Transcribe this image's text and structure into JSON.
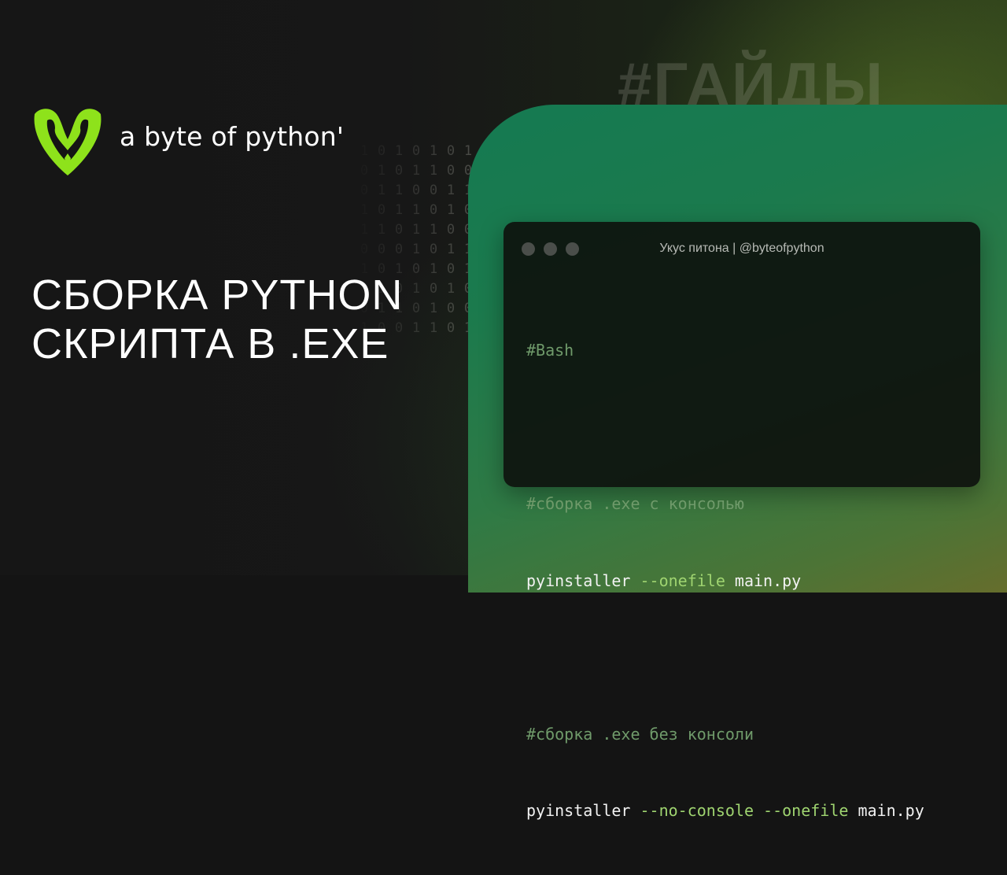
{
  "brand": {
    "name": "a byte of python'",
    "logo_icon": "snake-v-logo-icon",
    "accent_color": "#8ee21b"
  },
  "hashtag": "#ГАЙДЫ",
  "headline": {
    "line1": "СБОРКА PYTHON",
    "line2": "СКРИПТА В .EXE"
  },
  "terminal": {
    "title": "Укус питона | @byteofpython",
    "window_buttons": [
      "dot-icon",
      "dot-icon",
      "dot-icon"
    ],
    "lines": [
      {
        "kind": "comment",
        "text": "#Bash"
      },
      {
        "kind": "blank",
        "text": ""
      },
      {
        "kind": "comment",
        "text": "#сборка .exe с консолью"
      },
      {
        "kind": "command",
        "cmd": "pyinstaller",
        "flags": "--onefile",
        "file": "main.py"
      },
      {
        "kind": "blank",
        "text": ""
      },
      {
        "kind": "comment",
        "text": "#сборка .exe без консоли"
      },
      {
        "kind": "command",
        "cmd": "pyinstaller",
        "flags": "--no-console --onefile",
        "file": "main.py"
      }
    ]
  },
  "binary_columns": [
    "1001101001",
    "0110100110",
    "1011001010",
    "0101110101",
    "1100101011",
    "0011010100",
    "1010011001"
  ],
  "colors": {
    "background": "#141414",
    "panel_green": "#1b7a4d",
    "comment": "#6f9a6a",
    "flag": "#9fd470"
  }
}
